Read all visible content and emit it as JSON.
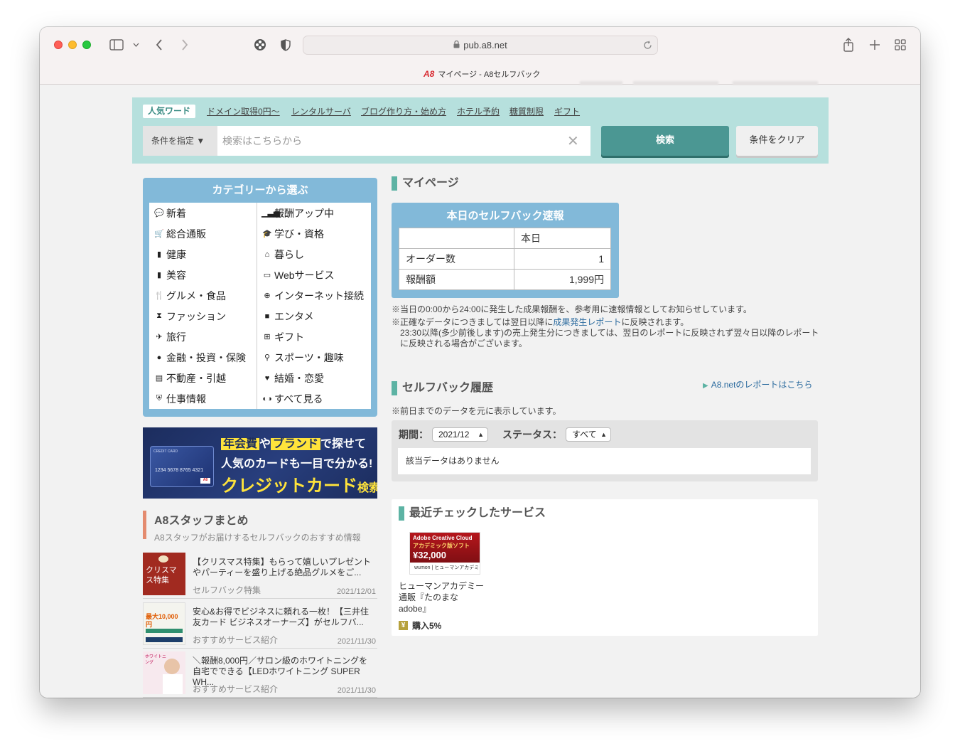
{
  "browser": {
    "url": "pub.a8.net",
    "tab_logo": "A8",
    "tab_title": "マイページ - A8セルフバック"
  },
  "search": {
    "keywords_label": "人気ワード",
    "keywords": [
      "ドメイン取得0円〜",
      "レンタルサーバ",
      "ブログ作り方・始め方",
      "ホテル予約",
      "糖質制限",
      "ギフト"
    ],
    "condition_button": "条件を指定 ▼",
    "placeholder": "検索はこちらから",
    "clear_glyph": "✕",
    "search_button": "検索",
    "clear_conditions_button": "条件をクリア"
  },
  "categories": {
    "title": "カテゴリーから選ぶ",
    "items": [
      {
        "label": "新着",
        "icon": "speech-bubble-icon",
        "glyph": "💬"
      },
      {
        "label": "報酬アップ中",
        "icon": "bar-chart-icon",
        "glyph": "▁▃▅"
      },
      {
        "label": "総合通販",
        "icon": "cart-icon",
        "glyph": "🛒"
      },
      {
        "label": "学び・資格",
        "icon": "graduation-cap-icon",
        "glyph": "🎓"
      },
      {
        "label": "健康",
        "icon": "bottle-icon",
        "glyph": "▮"
      },
      {
        "label": "暮らし",
        "icon": "house-icon",
        "glyph": "⌂"
      },
      {
        "label": "美容",
        "icon": "cosmetics-icon",
        "glyph": "▮"
      },
      {
        "label": "Webサービス",
        "icon": "monitor-icon",
        "glyph": "▭"
      },
      {
        "label": "グルメ・食品",
        "icon": "fork-knife-icon",
        "glyph": "🍴"
      },
      {
        "label": "インターネット接続",
        "icon": "globe-icon",
        "glyph": "⊕"
      },
      {
        "label": "ファッション",
        "icon": "dress-icon",
        "glyph": "⧗"
      },
      {
        "label": "エンタメ",
        "icon": "camera-icon",
        "glyph": "■"
      },
      {
        "label": "旅行",
        "icon": "airplane-icon",
        "glyph": "✈"
      },
      {
        "label": "ギフト",
        "icon": "gift-icon",
        "glyph": "⊞"
      },
      {
        "label": "金融・投資・保険",
        "icon": "money-bag-icon",
        "glyph": "●"
      },
      {
        "label": "スポーツ・趣味",
        "icon": "sports-icon",
        "glyph": "⚲"
      },
      {
        "label": "不動産・引越",
        "icon": "truck-icon",
        "glyph": "▤"
      },
      {
        "label": "結婚・恋愛",
        "icon": "heart-icon",
        "glyph": "♥"
      },
      {
        "label": "仕事情報",
        "icon": "person-icon",
        "glyph": "⛨"
      },
      {
        "label": "すべて見る",
        "icon": "binoculars-icon",
        "glyph": "◐◑"
      }
    ]
  },
  "credit_banner": {
    "line1_hl1": "年会費",
    "line1_mid": "や",
    "line1_hl2": "ブランド",
    "line1_end": "で探せて",
    "line2": "人気のカードも一目で分かる!",
    "line3_main": "クレジットカード",
    "line3_small": "検索",
    "card_number": "1234 5678 8765 4321"
  },
  "staff": {
    "title": "A8スタッフまとめ",
    "subtitle": "A8スタッフがお届けするセルフバックのおすすめ情報",
    "articles": [
      {
        "title": "【クリスマス特集】もらって嬉しいプレゼントやパーティーを盛り上げる絶品グルメをご...",
        "category": "セルフバック特集",
        "date": "2021/12/01",
        "thumb_text": "クリスマス特集"
      },
      {
        "title": "安心&お得でビジネスに頼れる一枚！【三井住友カード ビジネスオーナーズ】がセルフバ...",
        "category": "おすすめサービス紹介",
        "date": "2021/11/30",
        "thumb_text": "最大10,000円"
      },
      {
        "title": "＼報酬8,000円／サロン級のホワイトニングを自宅でできる【LEDホワイトニング SUPER WH...",
        "category": "おすすめサービス紹介",
        "date": "2021/11/30",
        "thumb_text": "ホワイトニング"
      }
    ]
  },
  "mypage": {
    "title": "マイページ",
    "speed": {
      "title": "本日のセルフバック速報",
      "col_header": "本日",
      "rows": [
        {
          "label": "オーダー数",
          "value": "1"
        },
        {
          "label": "報酬額",
          "value": "1,999円"
        }
      ]
    },
    "note1": "※当日の0:00から24:00に発生した成果報酬を、参考用に速報情報としてお知らせしています。",
    "note2_pre": "※正確なデータにつきましては翌日以降に",
    "note2_link": "成果発生レポート",
    "note2_post": "に反映されます。",
    "note3": "23:30以降(多少前後します)の売上発生分につきましては、翌日のレポートに反映されず翌々日以降のレポートに反映される場合がございます。",
    "report_link": "A8.netのレポートはこちら"
  },
  "history": {
    "title": "セルフバック履歴",
    "note": "※前日までのデータを元に表示しています。",
    "period_label": "期間：",
    "period_value": "2021/12",
    "status_label": "ステータス：",
    "status_value": "すべて",
    "empty": "該当データはありません"
  },
  "recent": {
    "title": "最近チェックしたサービス",
    "service": {
      "banner_t1": "Adobe Creative Cloud",
      "banner_t2": "アカデミック版ソフト",
      "banner_price": "¥32,000",
      "banner_foot": "wumon | ヒューマンアカデミー",
      "name": "ヒューマンアカデミー通販『たのまな　adobe』",
      "rate": "購入5%"
    }
  },
  "colors": {
    "search_band": "#b6e0dd",
    "accent_teal": "#4b9793",
    "category_blue": "#82b9d9",
    "section_bar": "#5db3a4",
    "staff_bar": "#e48b6f"
  }
}
